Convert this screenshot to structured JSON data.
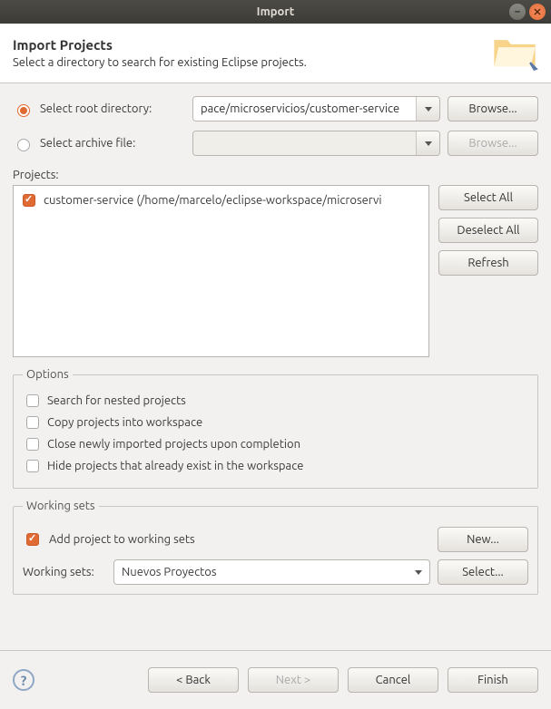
{
  "window": {
    "title": "Import"
  },
  "header": {
    "title": "Import Projects",
    "subtitle": "Select a directory to search for existing Eclipse projects."
  },
  "source": {
    "root_label": "Select root directory:",
    "root_value": "pace/microservicios/customer-service",
    "archive_label": "Select archive file:",
    "archive_value": "",
    "browse": "Browse...",
    "selected": "root"
  },
  "projects": {
    "label": "Projects:",
    "items": [
      {
        "label": "customer-service (/home/marcelo/eclipse-workspace/microservi",
        "checked": true
      }
    ],
    "select_all": "Select All",
    "deselect_all": "Deselect All",
    "refresh": "Refresh"
  },
  "options": {
    "legend": "Options",
    "search_nested": {
      "label": "Search for nested projects",
      "checked": false
    },
    "copy_workspace": {
      "label": "Copy projects into workspace",
      "checked": false
    },
    "close_imported": {
      "label": "Close newly imported projects upon completion",
      "checked": false
    },
    "hide_existing": {
      "label": "Hide projects that already exist in the workspace",
      "checked": false
    }
  },
  "working_sets": {
    "legend": "Working sets",
    "add_label": "Add project to working sets",
    "add_checked": true,
    "new": "New...",
    "label": "Working sets:",
    "value": "Nuevos Proyectos",
    "select": "Select..."
  },
  "footer": {
    "back": "< Back",
    "next": "Next >",
    "cancel": "Cancel",
    "finish": "Finish"
  }
}
